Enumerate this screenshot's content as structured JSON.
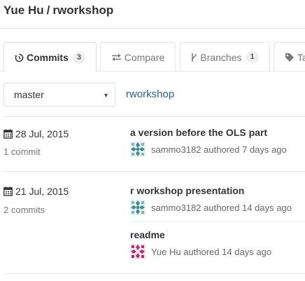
{
  "header": {
    "owner": "Yue Hu",
    "separator": "/",
    "repo": "rworkshop"
  },
  "tabs": [
    {
      "label": "Commits",
      "count": "3",
      "icon": "history-icon",
      "active": true
    },
    {
      "label": "Compare",
      "icon": "compare-arrows-icon"
    },
    {
      "label": "Branches",
      "count": "1",
      "icon": "branch-icon"
    },
    {
      "label": "Ta",
      "icon": "tag-icon"
    }
  ],
  "branch": {
    "selected": "master",
    "path_link": "rworkshop"
  },
  "days": [
    {
      "date": "28 Jul, 2015",
      "count_label": "1 commit",
      "commits": [
        {
          "title": "a version before the OLS part",
          "author": "sammo3182",
          "meta": "authored 7 days ago",
          "avatar_color": "#3c8c8c"
        }
      ]
    },
    {
      "date": "21 Jul, 2015",
      "count_label": "2 commits",
      "commits": [
        {
          "title": "r workshop presentation",
          "author": "sammo3182",
          "meta": "authored 14 days ago",
          "avatar_color": "#3c8c8c"
        },
        {
          "title": "readme",
          "author": "Yue Hu",
          "meta": "authored 14 days ago",
          "avatar_color": "#b0306e"
        }
      ]
    }
  ],
  "colors": {
    "link": "#2e5e8a",
    "avatar_teal": "#3c8c8c",
    "avatar_magenta": "#b0306e"
  }
}
